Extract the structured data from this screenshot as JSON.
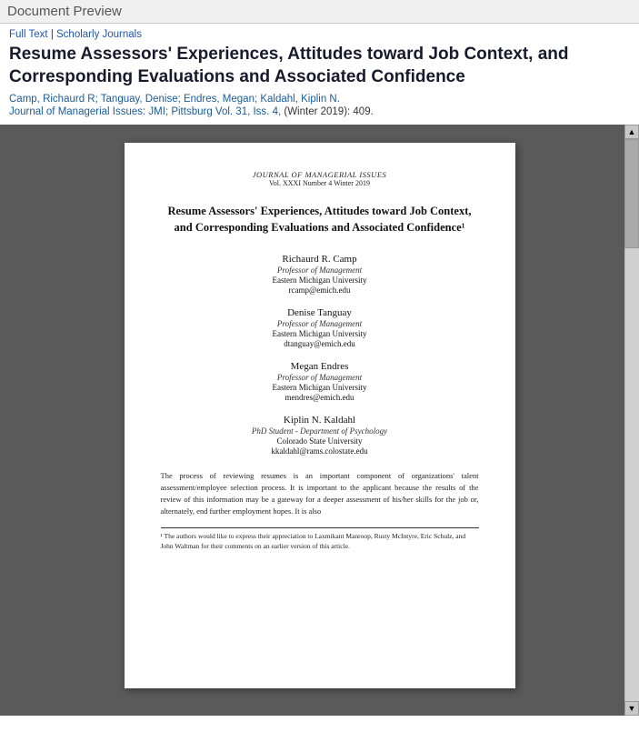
{
  "topBar": {
    "title": "Document Preview"
  },
  "meta": {
    "fullTextLabel": "Full Text",
    "separator": "|",
    "scholarlyLabel": "Scholarly Journals",
    "articleTitle": "Resume Assessors' Experiences, Attitudes toward Job Context, and Corresponding Evaluations and Associated Confidence",
    "authorsLine": "Camp, Richaurd R; Tanguay, Denise; Endres, Megan; Kaldahl, Kiplin N.",
    "journalLabel": "Journal of Managerial Issues: JMI; Pittsburg",
    "volumeInfo": "Vol. 31, Iss. 4,",
    "dateInfo": "(Winter 2019): 409."
  },
  "paper": {
    "journalName": "JOURNAL OF MANAGERIAL ISSUES",
    "journalVol": "Vol. XXXI   Number 4   Winter 2019",
    "title": "Resume Assessors' Experiences, Attitudes toward Job Context, and Corresponding Evaluations and Associated Confidence¹",
    "authors": [
      {
        "name": "Richaurd R. Camp",
        "title": "Professor of Management",
        "university": "Eastern Michigan University",
        "email": "rcamp@emich.edu"
      },
      {
        "name": "Denise Tanguay",
        "title": "Professor of Management",
        "university": "Eastern Michigan University",
        "email": "dtanguay@emich.edu"
      },
      {
        "name": "Megan Endres",
        "title": "Professor of Management",
        "university": "Eastern Michigan University",
        "email": "mendres@emich.edu"
      },
      {
        "name": "Kiplin N. Kaldahl",
        "title": "PhD Student - Department of Psychology",
        "university": "Colorado State University",
        "email": "kkaldahl@rams.colostate.edu"
      }
    ],
    "abstractText": "The process of reviewing resumes is an important component of organizations' talent assessment/employee selection process. It is important to the applicant because the results of the review of this information may be a gateway for a deeper assessment of his/her skills for the job or, alternately, end further employment hopes. It is also",
    "footnoteText": "¹ The authors would like to express their appreciation to Laxmikant Manroop, Rusty McIntyre, Eric Schulz, and John Waltman for their comments on an earlier version of this article."
  }
}
